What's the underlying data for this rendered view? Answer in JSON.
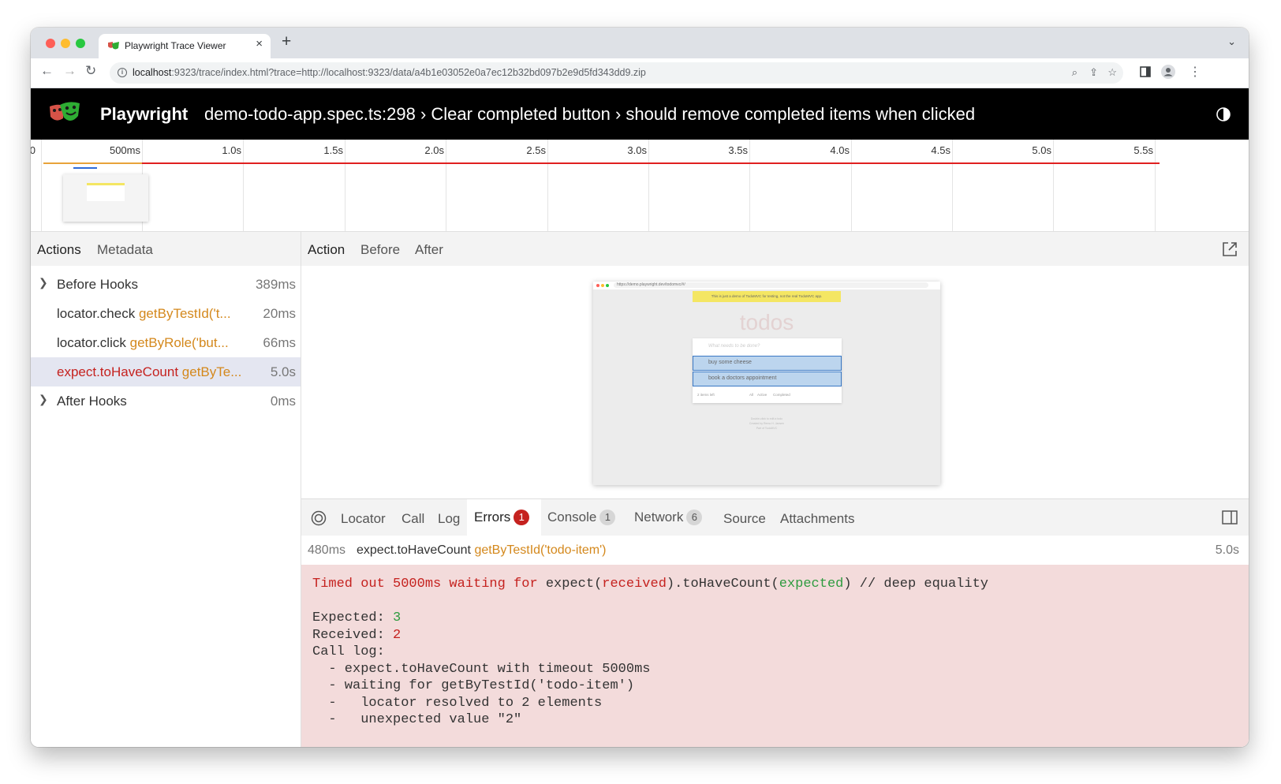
{
  "browser": {
    "tab_title": "Playwright Trace Viewer",
    "url_host": "localhost",
    "url_rest": ":9323/trace/index.html?trace=http://localhost:9323/data/a4b1e03052e0a7ec12b32bd097b2e9d5fd343dd9.zip"
  },
  "header": {
    "app_title": "Playwright",
    "test_title": "demo-todo-app.spec.ts:298 › Clear completed button › should remove completed items when clicked"
  },
  "timeline": {
    "start_label": "0",
    "ticks": [
      "500ms",
      "1.0s",
      "1.5s",
      "2.0s",
      "2.5s",
      "3.0s",
      "3.5s",
      "4.0s",
      "4.5s",
      "5.0s",
      "5.5s"
    ]
  },
  "sidebar": {
    "tabs": [
      "Actions",
      "Metadata"
    ],
    "actions": [
      {
        "name": "Before Hooks",
        "selector": "",
        "time": "389ms",
        "expandable": true
      },
      {
        "name": "locator.check",
        "selector": "getByTestId('t...",
        "time": "20ms",
        "expandable": false
      },
      {
        "name": "locator.click",
        "selector": "getByRole('but...",
        "time": "66ms",
        "expandable": false
      },
      {
        "name": "expect.toHaveCount",
        "selector": "getByTe...",
        "time": "5.0s",
        "expandable": false
      },
      {
        "name": "After Hooks",
        "selector": "",
        "time": "0ms",
        "expandable": true
      }
    ]
  },
  "snapshot": {
    "tabs": [
      "Action",
      "Before",
      "After"
    ],
    "url": "https://demo.playwright.dev/todomvc/#/",
    "banner": "This is just a demo of TodoMVC for testing, not the real TodoMVC app.",
    "title": "todos",
    "input_placeholder": "What needs to be done?",
    "items": [
      "buy some cheese",
      "book a doctors appointment"
    ],
    "footer_count": "2 items left",
    "footer_filters": [
      "All",
      "Active",
      "Completed"
    ],
    "footer_lines": [
      "Double-click to edit a todo",
      "Created by Remo H. Jansen",
      "Part of TodoMVC"
    ]
  },
  "bottom": {
    "tabs": {
      "locator": "Locator",
      "call": "Call",
      "log": "Log",
      "errors": "Errors",
      "errors_count": "1",
      "console": "Console",
      "console_count": "1",
      "network": "Network",
      "network_count": "6",
      "source": "Source",
      "attachments": "Attachments"
    },
    "error_time": "480ms",
    "error_action": "expect.toHaveCount",
    "error_selector": "getByTestId('todo-item')",
    "error_duration": "5.0s",
    "msg": {
      "p1": "Timed out 5000ms waiting for",
      "p2": " expect(",
      "p3": "received",
      "p4": ").toHaveCount(",
      "p5": "expected",
      "p6": ") // deep equality",
      "expected_label": "Expected: ",
      "expected_value": "3",
      "received_label": "Received: ",
      "received_value": "2",
      "call_log": "Call log:",
      "log_lines": [
        "  - expect.toHaveCount with timeout 5000ms",
        "  - waiting for getByTestId('todo-item')",
        "  -   locator resolved to 2 elements",
        "  -   unexpected value \"2\""
      ]
    }
  }
}
